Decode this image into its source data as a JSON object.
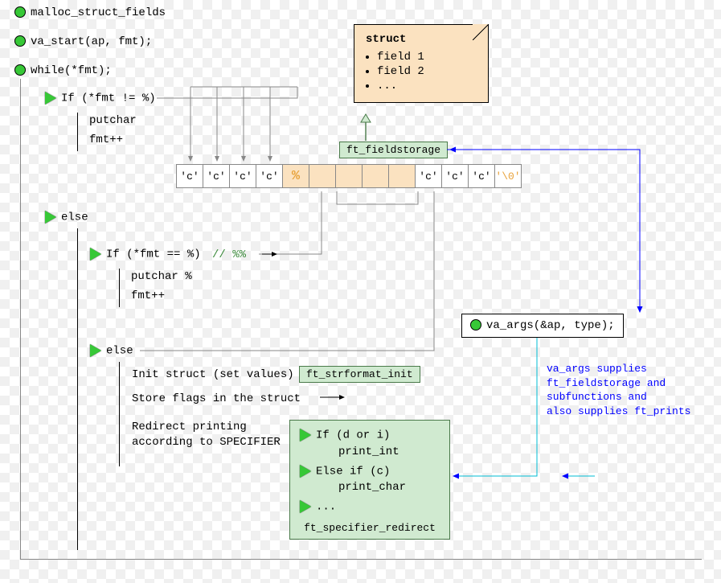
{
  "top_statements": {
    "s1": "malloc_struct_fields",
    "s2": "va_start(ap, fmt);",
    "s3": "while(*fmt);"
  },
  "branch1": {
    "cond": "If (*fmt != %)",
    "body1": "putchar",
    "body2": "fmt++"
  },
  "else_label": "else",
  "branch2": {
    "cond": "If (*fmt == %)",
    "comment": "// %%",
    "body1": "putchar %",
    "body2": "fmt++"
  },
  "branch3": {
    "label": "else",
    "l1": "Init struct (set values)",
    "l2": "Store flags in the struct",
    "l3a": "Redirect printing",
    "l3b": "according to SPECIFIER"
  },
  "tags": {
    "fieldstorage": "ft_fieldstorage",
    "strformat": "ft_strformat_init"
  },
  "struct_note": {
    "title": "struct",
    "items": [
      "field 1",
      "field 2",
      "..."
    ]
  },
  "tape": [
    "'c'",
    "'c'",
    "'c'",
    "'c'",
    "%",
    "",
    "",
    "",
    "",
    "'c'",
    "'c'",
    "'c'",
    "'\\0'"
  ],
  "va_args": "va_args(&ap, type);",
  "blue_note": {
    "l1": "va_args supplies",
    "l2": "ft_fieldstorage and",
    "l3": "subfunctions and",
    "l4": "also supplies ft_prints"
  },
  "redirect": {
    "r1": "If (d or i)",
    "r1b": "print_int",
    "r2": "Else if (c)",
    "r2b": "print_char",
    "r3": "...",
    "caption": "ft_specifier_redirect"
  }
}
